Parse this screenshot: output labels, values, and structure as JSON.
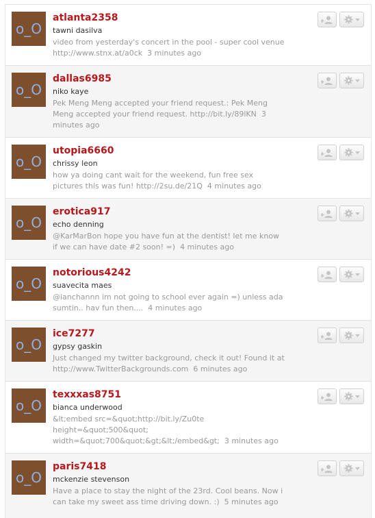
{
  "users": [
    {
      "username": "atlanta2358",
      "fullname": "tawni dasilva",
      "tweet": "video from yesterday's concert in the pool - super cool venue http://www.stnx.at/a0ck",
      "time": "3 minutes ago",
      "avatar_text": "o_O"
    },
    {
      "username": "dallas6985",
      "fullname": "niko kaye",
      "tweet": "Pek Meng Meng accepted your friend request.: Pek Meng Meng accepted your friend request. http://bit.ly/89lKN",
      "time": "3 minutes ago",
      "avatar_text": "o_O"
    },
    {
      "username": "utopia6660",
      "fullname": "chrissy leon",
      "tweet": "how ya doing cant wait for the weekend, fun free sex pictures this was fun! http://2su.de/21Q",
      "time": "4 minutes ago",
      "avatar_text": "o_O"
    },
    {
      "username": "erotica917",
      "fullname": "echo denning",
      "tweet": "@KarMarBon hope you have fun at the dentist! let me know if we can have date #2 soon! =)",
      "time": "4 minutes ago",
      "avatar_text": "o_O"
    },
    {
      "username": "notorious4242",
      "fullname": "suavecita maes",
      "tweet": "@ianchannn im not going to school ever again =) unless ada sumtin.. hav fun then....",
      "time": "4 minutes ago",
      "avatar_text": "o_O"
    },
    {
      "username": "ice7277",
      "fullname": "gypsy gaskin",
      "tweet": "Just changed my twitter background, check it out! Found it at http://www.TwitterBackgrounds.com",
      "time": "6 minutes ago",
      "avatar_text": "o_O"
    },
    {
      "username": "texxxas8751",
      "fullname": "bianca underwood",
      "tweet": "&lt;embed src=&quot;http://bit.ly/Zu0te height=&quot;500&quot; width=&quot;700&quot;&gt;&lt;/embed&gt;",
      "time": "3 minutes ago",
      "avatar_text": "o_O"
    },
    {
      "username": "paris7418",
      "fullname": "mckenzie stevenson",
      "tweet": "Have a place to stay the night of the 23rd. Cool beans. Now i can take my sweet ass time driving down. :)",
      "time": "5 minutes ago",
      "avatar_text": "o_O"
    }
  ],
  "colors": {
    "username": "#b8181b",
    "avatar_bg": "#7d4f2c",
    "avatar_text": "#8fb0e6",
    "row_alt_bg": "#f5f5f5"
  },
  "icons": {
    "follow": "person-plus-icon",
    "actions": "gear-icon",
    "dropdown": "chevron-down-icon"
  }
}
